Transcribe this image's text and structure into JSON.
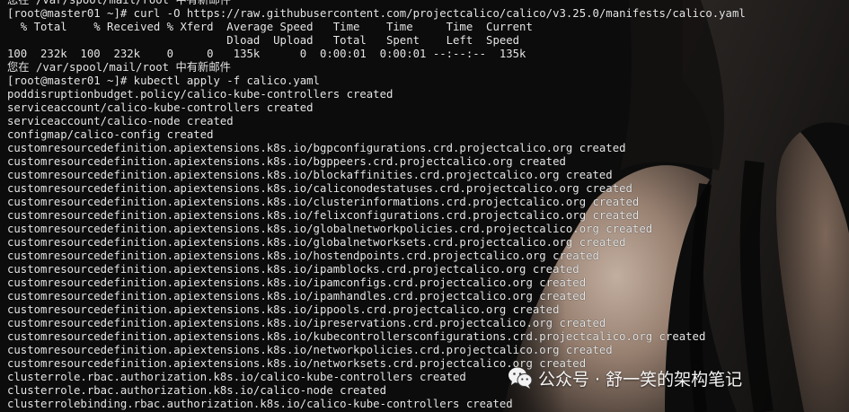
{
  "terminal": {
    "lines": [
      "您在 /var/spool/mail/root 中有新邮件",
      "[root@master01 ~]# curl -O https://raw.githubusercontent.com/projectcalico/calico/v3.25.0/manifests/calico.yaml",
      "  % Total    % Received % Xferd  Average Speed   Time    Time     Time  Current",
      "                                 Dload  Upload   Total   Spent    Left  Speed",
      "100  232k  100  232k    0     0   135k      0  0:00:01  0:00:01 --:--:--  135k",
      "您在 /var/spool/mail/root 中有新邮件",
      "[root@master01 ~]# kubectl apply -f calico.yaml",
      "poddisruptionbudget.policy/calico-kube-controllers created",
      "serviceaccount/calico-kube-controllers created",
      "serviceaccount/calico-node created",
      "configmap/calico-config created",
      "customresourcedefinition.apiextensions.k8s.io/bgpconfigurations.crd.projectcalico.org created",
      "customresourcedefinition.apiextensions.k8s.io/bgppeers.crd.projectcalico.org created",
      "customresourcedefinition.apiextensions.k8s.io/blockaffinities.crd.projectcalico.org created",
      "customresourcedefinition.apiextensions.k8s.io/caliconodestatuses.crd.projectcalico.org created",
      "customresourcedefinition.apiextensions.k8s.io/clusterinformations.crd.projectcalico.org created",
      "customresourcedefinition.apiextensions.k8s.io/felixconfigurations.crd.projectcalico.org created",
      "customresourcedefinition.apiextensions.k8s.io/globalnetworkpolicies.crd.projectcalico.org created",
      "customresourcedefinition.apiextensions.k8s.io/globalnetworksets.crd.projectcalico.org created",
      "customresourcedefinition.apiextensions.k8s.io/hostendpoints.crd.projectcalico.org created",
      "customresourcedefinition.apiextensions.k8s.io/ipamblocks.crd.projectcalico.org created",
      "customresourcedefinition.apiextensions.k8s.io/ipamconfigs.crd.projectcalico.org created",
      "customresourcedefinition.apiextensions.k8s.io/ipamhandles.crd.projectcalico.org created",
      "customresourcedefinition.apiextensions.k8s.io/ippools.crd.projectcalico.org created",
      "customresourcedefinition.apiextensions.k8s.io/ipreservations.crd.projectcalico.org created",
      "customresourcedefinition.apiextensions.k8s.io/kubecontrollersconfigurations.crd.projectcalico.org created",
      "customresourcedefinition.apiextensions.k8s.io/networkpolicies.crd.projectcalico.org created",
      "customresourcedefinition.apiextensions.k8s.io/networksets.crd.projectcalico.org created",
      "clusterrole.rbac.authorization.k8s.io/calico-kube-controllers created",
      "clusterrole.rbac.authorization.k8s.io/calico-node created",
      "clusterrolebinding.rbac.authorization.k8s.io/calico-kube-controllers created"
    ]
  },
  "watermark": {
    "icon": "wechat-icon",
    "text": "公众号 · 舒一笑的架构笔记"
  },
  "colors": {
    "background": "#0c0c0c",
    "text": "#e6e6e6",
    "skin_highlight": "#c9b3a3",
    "watermark_text": "#f3f3f3"
  }
}
